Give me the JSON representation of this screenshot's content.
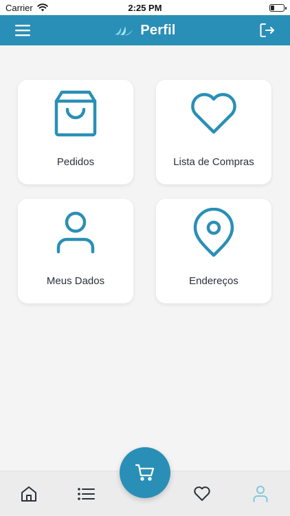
{
  "status_bar": {
    "carrier": "Carrier",
    "time": "2:25 PM"
  },
  "header": {
    "title": "Perfil"
  },
  "cards": [
    {
      "label": "Pedidos",
      "icon": "shopping-bag-icon"
    },
    {
      "label": "Lista de Compras",
      "icon": "heart-icon"
    },
    {
      "label": "Meus Dados",
      "icon": "user-icon"
    },
    {
      "label": "Endereços",
      "icon": "map-pin-icon"
    }
  ],
  "tab_bar": {
    "tabs": [
      {
        "icon": "home-icon"
      },
      {
        "icon": "list-icon"
      },
      {
        "icon": "heart-icon"
      },
      {
        "icon": "user-icon",
        "active": true
      }
    ],
    "fab_icon": "cart-icon"
  },
  "colors": {
    "primary": "#2a8fb6",
    "background": "#f4f4f4",
    "card": "#ffffff",
    "text": "#2a2f3a",
    "tab_active": "#7fc8e0",
    "tab_inactive": "#2a2f3a"
  }
}
